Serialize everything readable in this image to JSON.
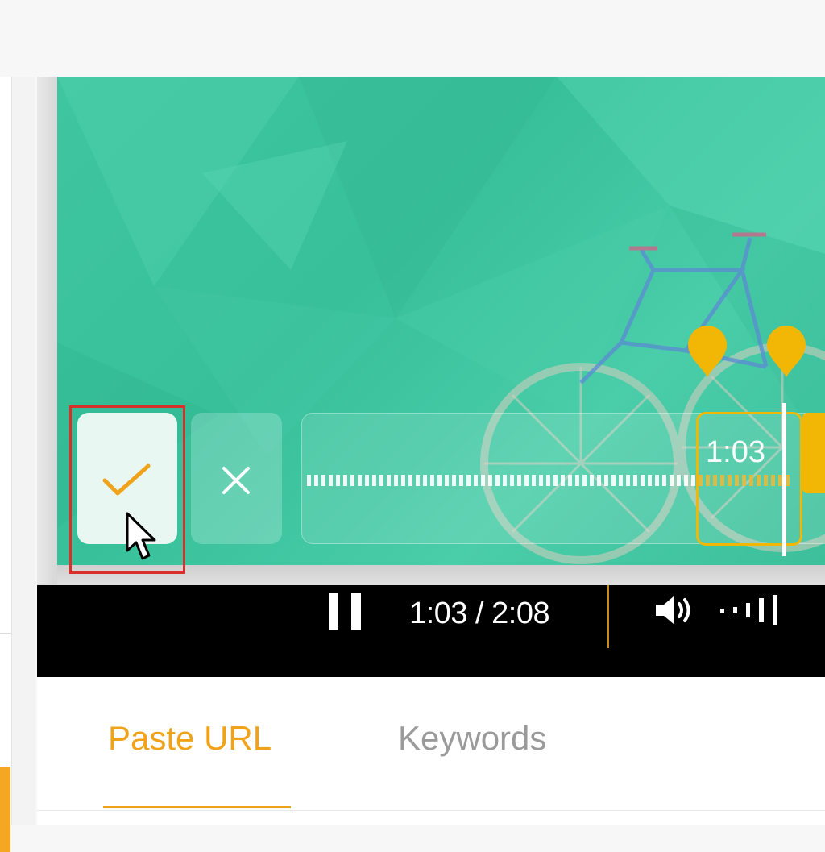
{
  "editor": {
    "confirm_icon": "checkmark-icon",
    "cancel_icon": "close-icon",
    "timeline": {
      "window_time_label": "1:03",
      "markers": 2
    }
  },
  "player": {
    "time_display": "1:03 / 2:08",
    "pause_icon": "pause-icon",
    "volume_icon": "speaker-icon",
    "volume_level_icon": "volume-level-icon"
  },
  "tabs": [
    {
      "label": "Paste URL",
      "active": true
    },
    {
      "label": "Keywords",
      "active": false
    }
  ],
  "colors": {
    "accent": "#f0a31a",
    "marker": "#f2b705",
    "highlight": "#d9302c",
    "video_bg": "#3fc6a0"
  }
}
